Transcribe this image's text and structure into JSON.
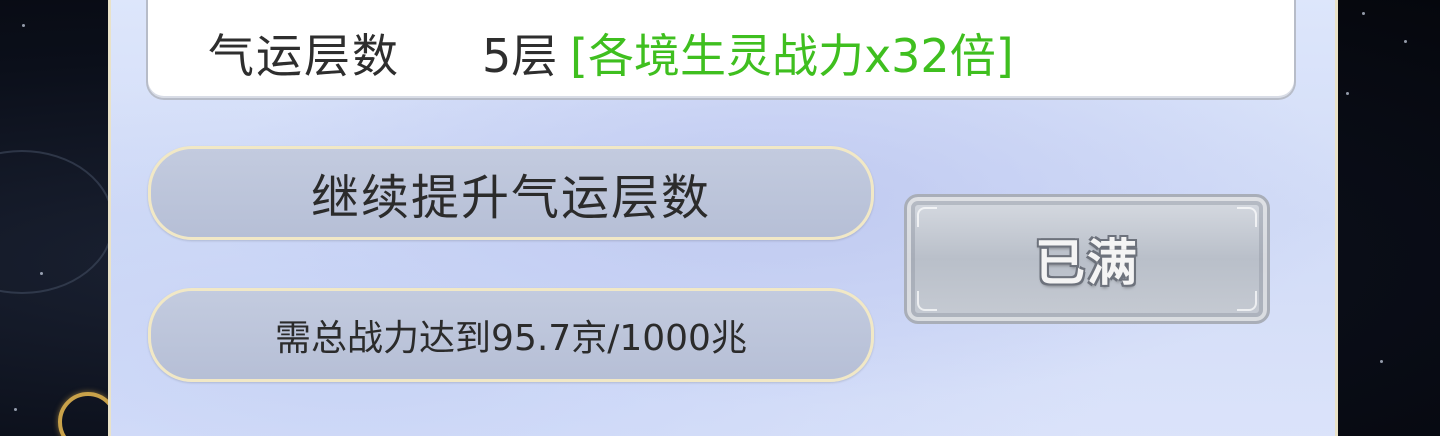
{
  "luck": {
    "label": "气运层数",
    "value": "5层",
    "bonus": "[各境生灵战力x32倍]"
  },
  "upgrade_button": {
    "label": "继续提升气运层数"
  },
  "requirement": {
    "text": "需总战力达到95.7京/1000兆"
  },
  "status_button": {
    "label": "已满"
  },
  "colors": {
    "bonus_green": "#3fbf1f",
    "panel_bg": "#d2dcf7",
    "pill_bg": "#b6bfd6",
    "disabled_button": "#c6cbd3"
  }
}
